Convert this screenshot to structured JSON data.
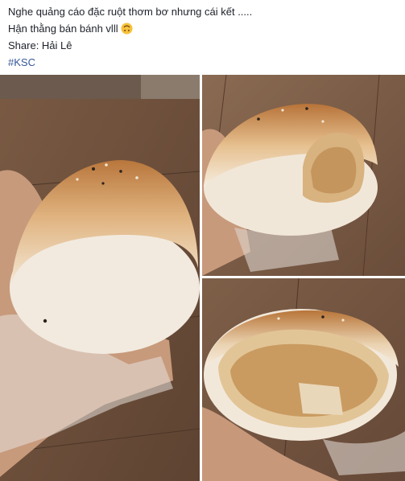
{
  "post": {
    "line1": "Nghe quảng cáo đặc ruột thơm bơ nhưng cái kết .....",
    "line2": "Hận thằng bán bánh vlll",
    "line2_emoji": "upside-down-face-emoji",
    "line3": "Share: Hải Lê",
    "hashtag": "#KSC"
  },
  "colors": {
    "text": "#1d2129",
    "link": "#365899",
    "emoji": "#f7c13a"
  }
}
